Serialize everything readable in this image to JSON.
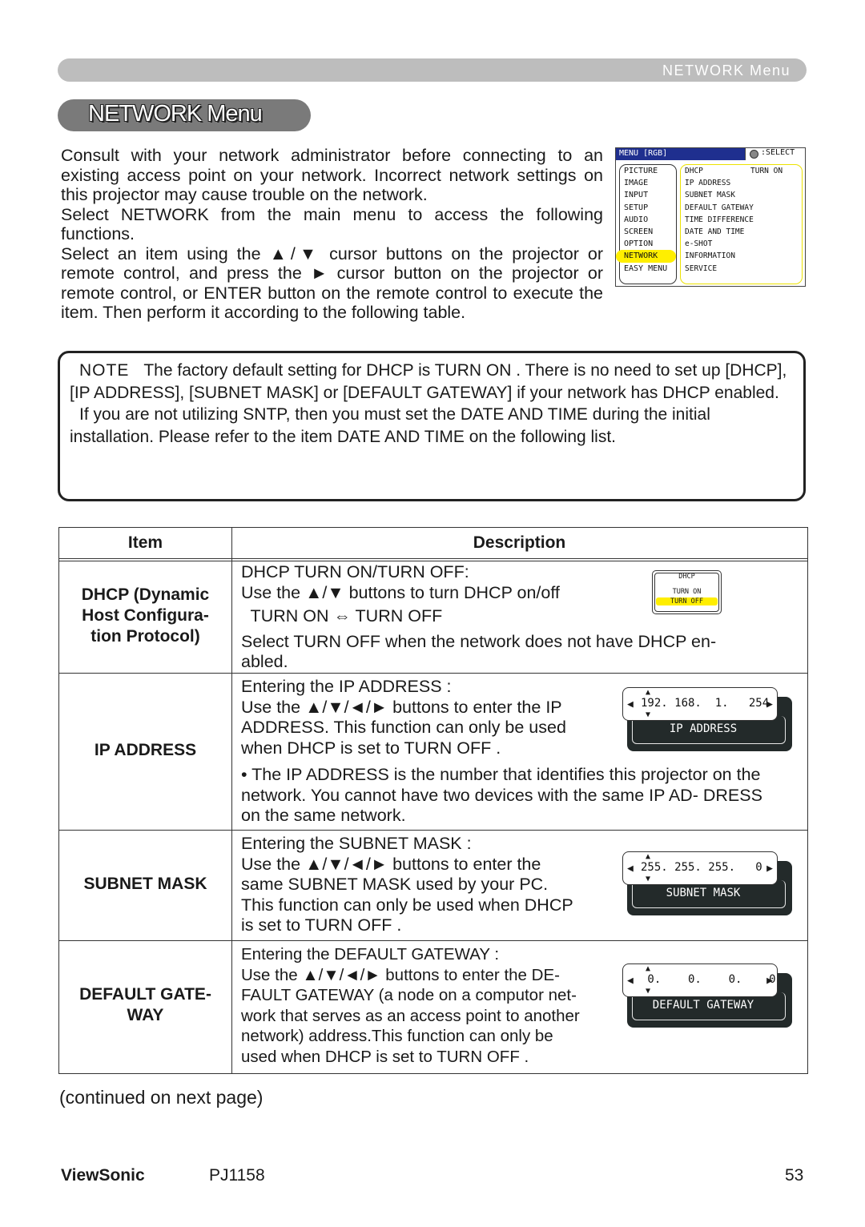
{
  "header": {
    "section_label": "NETWORK Menu",
    "title": "NETWORK Menu"
  },
  "intro": [
    "Consult with your network administrator before connecting to an existing access point on your network. Incorrect network settings on this projector may cause trouble on the network.",
    "Select  NETWORK  from the main menu to access the following functions.",
    "Select an item using the ▲/▼ cursor buttons on the projector or remote control, and press the ► cursor button on the projector or remote control, or ENTER button on the remote control to execute the item. Then perform it according to the following table."
  ],
  "osd_menu": {
    "title": "MENU [RGB]",
    "select_hint": ":SELECT",
    "left_items": [
      "PICTURE",
      "IMAGE",
      "INPUT",
      "SETUP",
      "AUDIO",
      "SCREEN",
      "OPTION",
      "NETWORK",
      "EASY MENU"
    ],
    "active_item": "NETWORK",
    "right_items": [
      {
        "label": "DHCP",
        "value": "TURN ON"
      },
      {
        "label": "IP ADDRESS",
        "value": ""
      },
      {
        "label": "SUBNET MASK",
        "value": ""
      },
      {
        "label": "DEFAULT GATEWAY",
        "value": ""
      },
      {
        "label": "TIME DIFFERENCE",
        "value": ""
      },
      {
        "label": "DATE AND TIME",
        "value": ""
      },
      {
        "label": "e-SHOT",
        "value": ""
      },
      {
        "label": "INFORMATION",
        "value": ""
      },
      {
        "label": "SERVICE",
        "value": ""
      }
    ],
    "colors": {
      "header_bg": "#1f2f8f",
      "highlight": "#ffef00"
    }
  },
  "note": {
    "label": "NOTE",
    "p1": "The factory default setting for DHCP is  TURN ON . There is no need to set up [DHCP], [IP ADDRESS], [SUBNET MASK] or [DEFAULT GATEWAY] if your network has DHCP enabled.",
    "p2": "If you are not utilizing SNTP, then you must set the DATE AND TIME during the initial installation. Please refer to the item DATE AND TIME on the following list."
  },
  "table": {
    "headers": {
      "item": "Item",
      "description": "Description"
    },
    "rows": [
      {
        "item": "DHCP (Dynamic Host Configura- tion Protocol)",
        "lines": [
          "DHCP TURN ON/TURN OFF:",
          "Use the ▲/▼ buttons to turn DHCP on/off",
          "  TURN ON ⇔ TURN OFF",
          "Select TURN OFF when the network does not have  DHCP en-",
          "abled."
        ],
        "widget": {
          "label": "DHCP",
          "options": [
            "TURN ON",
            "TURN OFF"
          ],
          "selected": "TURN OFF"
        }
      },
      {
        "item": "IP ADDRESS",
        "lines": [
          "Entering the IP ADDRESS :",
          "Use the ▲/▼/◄/► buttons to enter the IP",
          "ADDRESS. This function can only be used",
          "when DHCP is set to  TURN OFF ."
        ],
        "bullet": "• The IP ADDRESS is the number that identifies this projector on the network. You cannot have two devices with the same IP AD- DRESS on the same network.",
        "widget": {
          "label": "IP ADDRESS",
          "value": "192. 168.  1.   254"
        }
      },
      {
        "item": "SUBNET MASK",
        "lines": [
          "Entering the SUBNET MASK :",
          "Use the ▲/▼/◄/► buttons to enter the",
          "same SUBNET MASK used by your PC.",
          "This function can only be used when DHCP",
          "is set to  TURN OFF ."
        ],
        "widget": {
          "label": "SUBNET MASK",
          "value": "255. 255. 255.   0"
        }
      },
      {
        "item": "DEFAULT GATE- WAY",
        "lines": [
          "Entering the DEFAULT GATEWAY :",
          "Use the ▲/▼/◄/► buttons to enter the DE-",
          "FAULT GATEWAY (a node on a computor net-",
          "work that serves as an access point to another",
          "network) address.This function can only be",
          "used when DHCP is set to  TURN OFF ."
        ],
        "widget": {
          "label": "DEFAULT GATEWAY",
          "value": " 0.    0.    0.    0"
        }
      }
    ]
  },
  "continued": "(continued on next page)",
  "footer": {
    "brand": "ViewSonic",
    "model": "PJ1158",
    "page": "53"
  }
}
